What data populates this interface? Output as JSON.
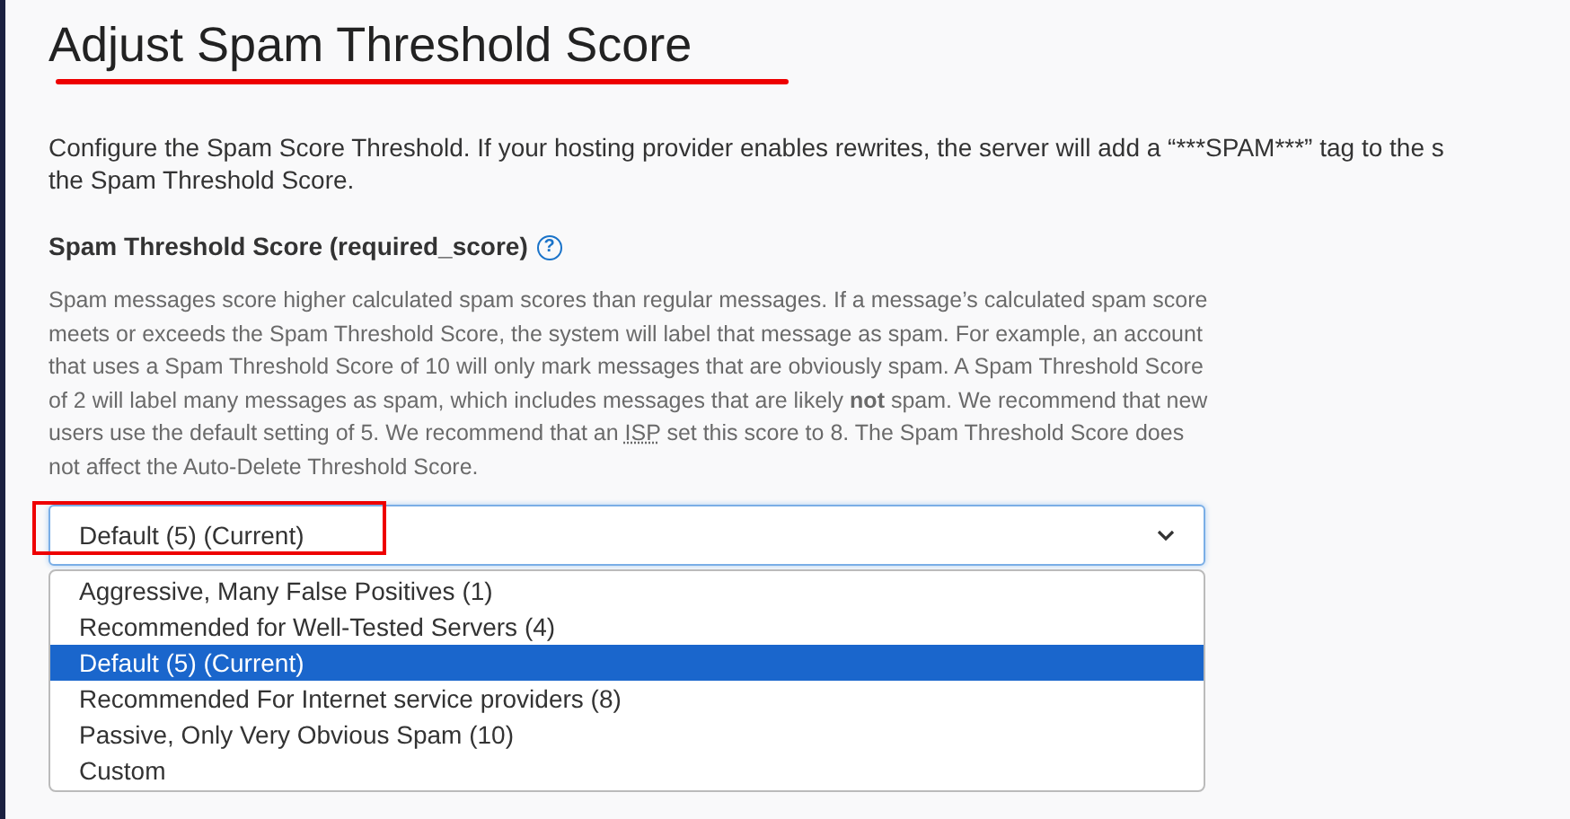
{
  "title": "Adjust Spam Threshold Score",
  "intro_lines": [
    "Configure the Spam Score Threshold. If your hosting provider enables rewrites, the server will add a “***SPAM***” tag to the s",
    "the Spam Threshold Score."
  ],
  "field_label": "Spam Threshold Score (required_score)",
  "help_icon": "?",
  "description": {
    "before": "Spam messages score higher calculated spam scores than regular messages. If a message’s calculated spam score meets or exceeds the Spam Threshold Score, the system will label that message as spam. For example, an account that uses a Spam Threshold Score of 10 will only mark messages that are obviously spam. A Spam Threshold Score of 2 will label many messages as spam, which includes messages that are likely **not** spam. We recommend that new users use the default setting of 5. We recommend that an ",
    "abbr": "ISP",
    "after": " set this score to 8. The Spam Threshold Score does not affect the Auto-Delete Threshold Score."
  },
  "select": {
    "value": "Default (5) (Current)",
    "expanded": true,
    "options": [
      {
        "label": "Aggressive, Many False Positives (1)",
        "selected": false
      },
      {
        "label": "Recommended for Well-Tested Servers (4)",
        "selected": false
      },
      {
        "label": "Default (5) (Current)",
        "selected": true
      },
      {
        "label": "Recommended For Internet service providers (8)",
        "selected": false
      },
      {
        "label": "Passive, Only Very Obvious Spam (10)",
        "selected": false
      },
      {
        "label": "Custom",
        "selected": false
      }
    ]
  }
}
